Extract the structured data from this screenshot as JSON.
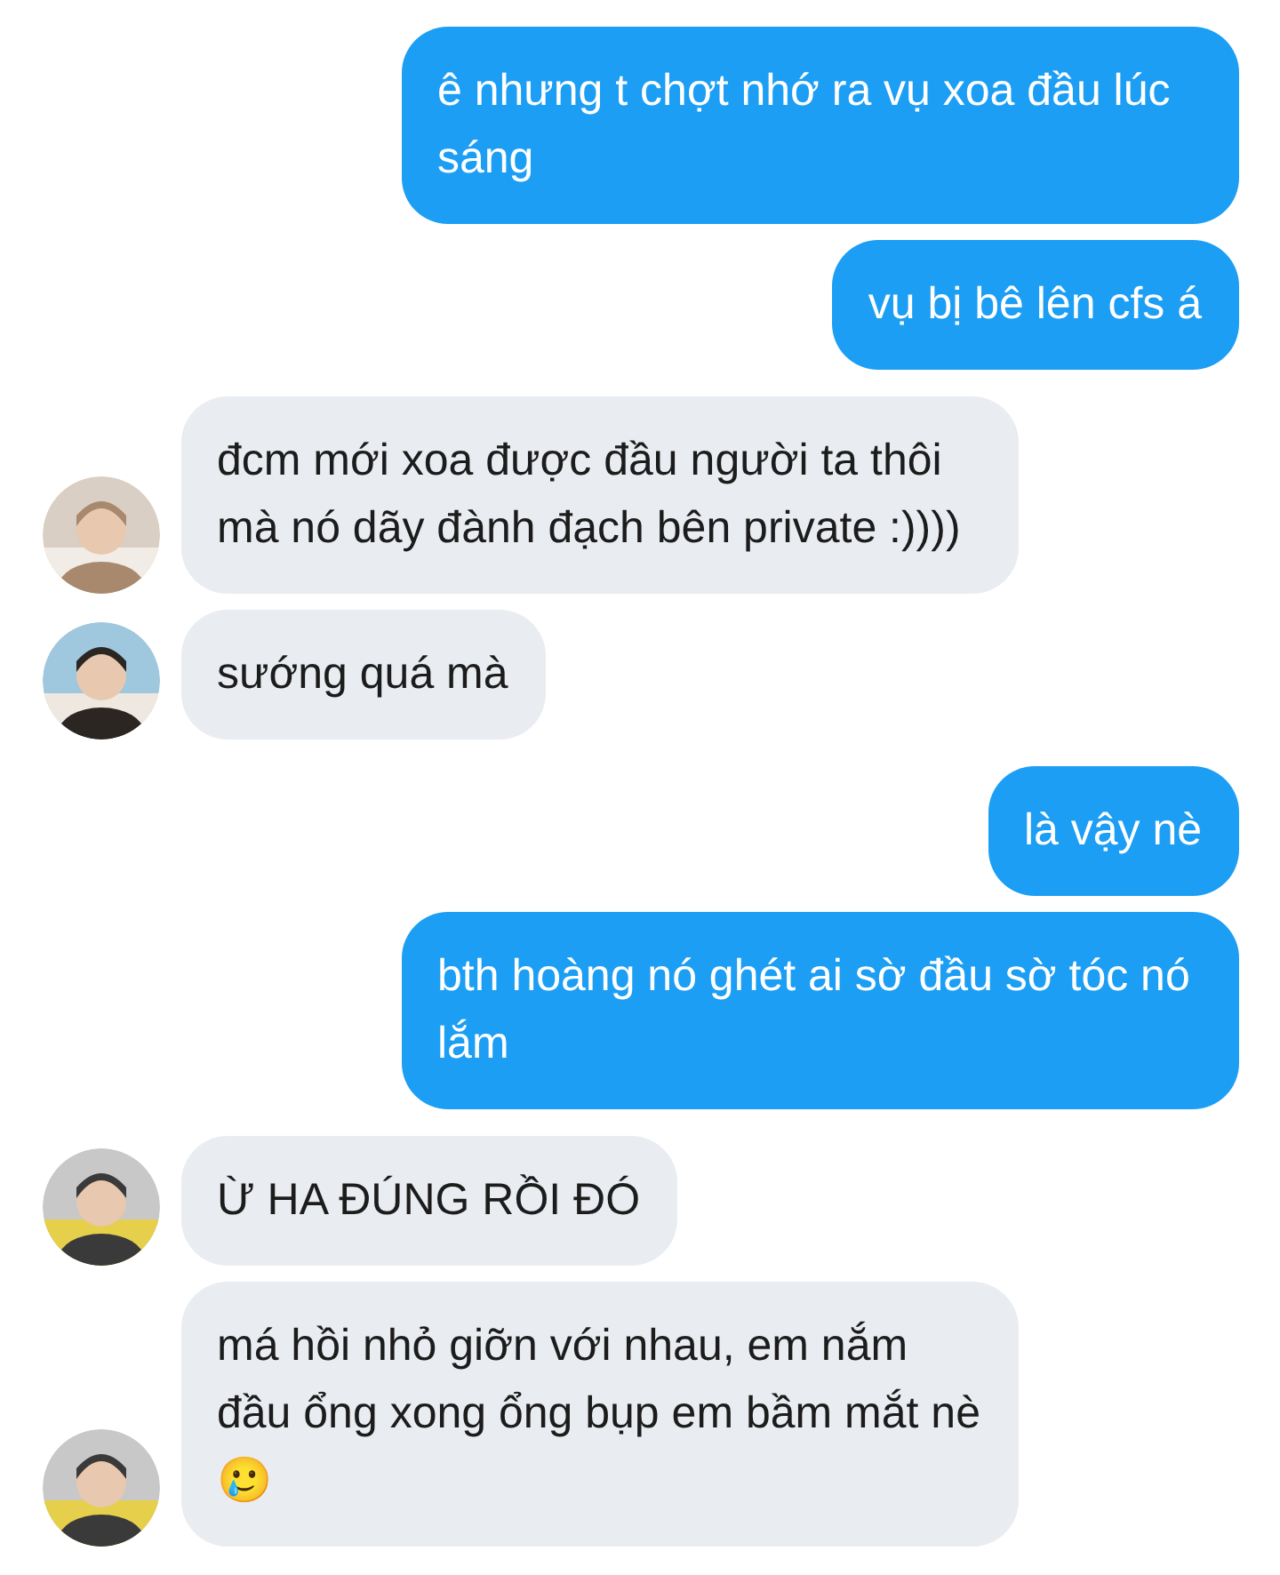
{
  "messages": [
    {
      "kind": "outgoing",
      "text": "ê nhưng t chợt nhớ ra vụ xoa đầu lúc sáng"
    },
    {
      "kind": "outgoing",
      "text": "vụ bị bê lên cfs á"
    },
    {
      "kind": "incoming",
      "text": "đcm mới xoa được đầu người ta thôi mà nó dãy đành đạch bên private :))))"
    },
    {
      "kind": "incoming",
      "text": "sướng quá mà"
    },
    {
      "kind": "outgoing",
      "text": "là vậy nè"
    },
    {
      "kind": "outgoing",
      "text": "bth hoàng nó ghét ai sờ đầu sờ tóc nó lắm"
    },
    {
      "kind": "incoming",
      "text": "Ừ HA ĐÚNG RỒI ĐÓ"
    },
    {
      "kind": "incoming",
      "text": "má hồi nhỏ giỡn với nhau, em nắm đầu ổng xong ổng bụp em bầm mắt nè 🥲"
    }
  ]
}
